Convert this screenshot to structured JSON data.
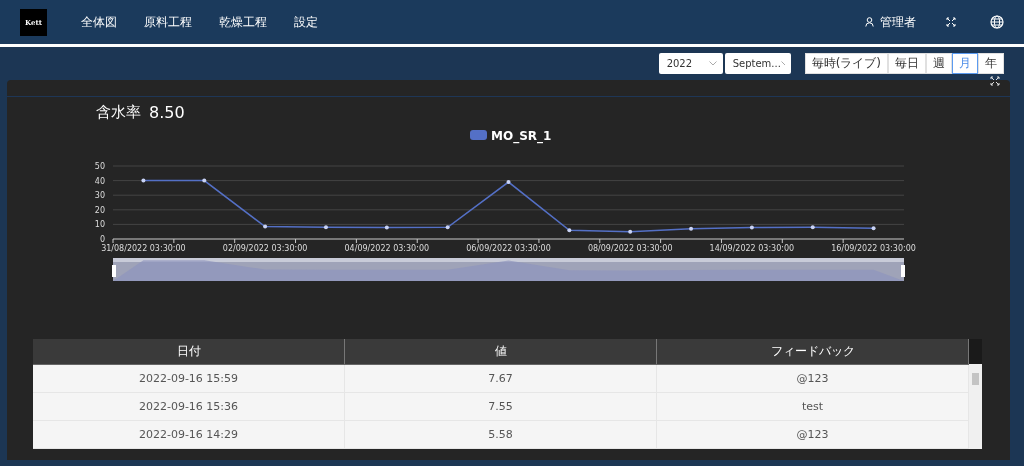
{
  "nav": {
    "logo": "Kett",
    "items": [
      {
        "label": "全体図",
        "selected": false
      },
      {
        "label": "原料工程",
        "selected": false
      },
      {
        "label": "乾燥工程",
        "selected": false
      },
      {
        "label": "設定",
        "selected": false
      }
    ],
    "user": "管理者"
  },
  "filters": {
    "year": "2022",
    "month": "Septem...",
    "periods": [
      {
        "label": "毎時(ライブ)",
        "selected": false
      },
      {
        "label": "毎日",
        "selected": false
      },
      {
        "label": "週",
        "selected": false
      },
      {
        "label": "月",
        "selected": true
      },
      {
        "label": "年",
        "selected": false
      }
    ]
  },
  "card": {
    "title": "含水率",
    "value": "8.50",
    "chart_data": {
      "type": "line",
      "categories": [
        "31/08/2022 03:30:00",
        null,
        "02/09/2022 03:30:00",
        null,
        "04/09/2022 03:30:00",
        null,
        "06/09/2022 03:30:00",
        null,
        "08/09/2022 03:30:00",
        null,
        "14/09/2022 03:30:00",
        null,
        "16/09/2022 03:30:00"
      ],
      "series": [
        {
          "name": "MO_SR_1",
          "color": "#5470c6",
          "values": [
            40,
            40,
            8.5,
            8,
            7.8,
            8,
            39,
            6,
            5,
            7,
            7.8,
            8,
            7.4
          ]
        }
      ],
      "ylim": [
        0,
        50
      ],
      "grid": true,
      "yticks": [
        0,
        10,
        20,
        30,
        40,
        50
      ]
    }
  },
  "table": {
    "columns": [
      "日付",
      "値",
      "フィードバック"
    ],
    "rows": [
      [
        "2022-09-16 15:59",
        "7.67",
        "@123"
      ],
      [
        "2022-09-16 15:36",
        "7.55",
        "test"
      ],
      [
        "2022-09-16 14:29",
        "5.58",
        "@123"
      ]
    ]
  }
}
